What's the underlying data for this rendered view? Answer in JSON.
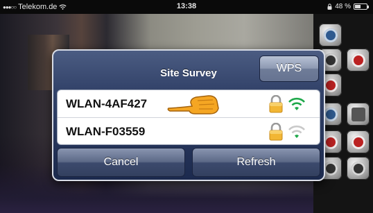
{
  "status_bar": {
    "signal_dots": "●●●○○",
    "carrier": "Telekom.de",
    "wifi_icon": "wifi-icon",
    "time": "13:38",
    "lock_icon": "lock-icon",
    "battery_text": "48 %",
    "battery_level": 0.48
  },
  "dialog": {
    "title": "Site Survey",
    "wps_label": "WPS",
    "networks": [
      {
        "ssid": "WLAN-4AF427",
        "secured": true,
        "signal": 3,
        "signal_color": "#1ea84a"
      },
      {
        "ssid": "WLAN-F03559",
        "secured": true,
        "signal": 1,
        "signal_color": "#1ea84a"
      }
    ],
    "cancel_label": "Cancel",
    "refresh_label": "Refresh",
    "pointer_color": "#f5a623"
  },
  "sidebar": {
    "controls": [
      "settings-icon",
      "audio-icon",
      "video-icon",
      "record-icon",
      "playback-icon",
      "snapshot-icon",
      "zoom-icon",
      "ptz-icon"
    ]
  }
}
